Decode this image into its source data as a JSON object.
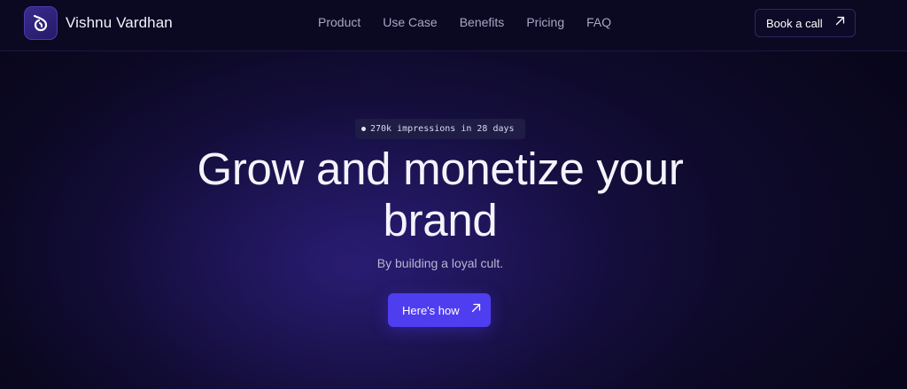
{
  "brand": {
    "name": "Vishnu Vardhan",
    "logo_icon": "swirl-logo-icon"
  },
  "nav": {
    "links": [
      "Product",
      "Use Case",
      "Benefits",
      "Pricing",
      "FAQ"
    ],
    "book_call_label": "Book a call"
  },
  "hero": {
    "badge": "270k impressions in 28 days",
    "headline_line1": "Grow and monetize your",
    "headline_line2": "brand",
    "subtitle": "By building a loyal cult.",
    "cta_label": "Here's how"
  },
  "colors": {
    "background": "#08061a",
    "accent": "#4f3ef0",
    "nav_text": "#a9a6c6",
    "badge_bg": "#1f1c45"
  }
}
